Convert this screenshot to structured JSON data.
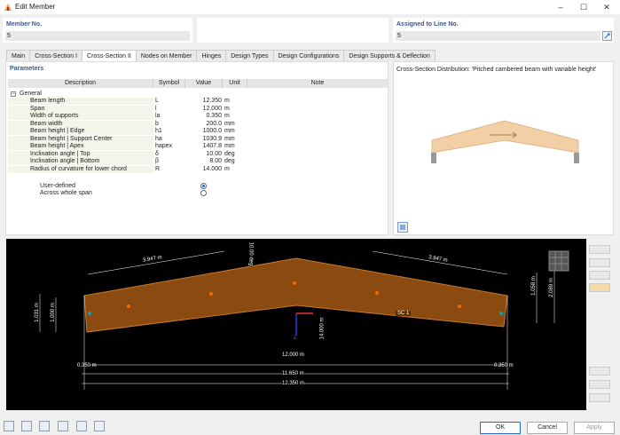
{
  "window": {
    "title": "Edit Member"
  },
  "header": {
    "member_no_label": "Member No.",
    "member_no_value": "5",
    "assigned_label": "Assigned to Line No.",
    "assigned_value": "5"
  },
  "tabs": [
    {
      "label": "Main"
    },
    {
      "label": "Cross-Section I"
    },
    {
      "label": "Cross-Section II"
    },
    {
      "label": "Nodes on Member"
    },
    {
      "label": "Hinges"
    },
    {
      "label": "Design Types"
    },
    {
      "label": "Design Configurations"
    },
    {
      "label": "Design Supports & Deflection"
    }
  ],
  "params": {
    "title": "Parameters",
    "columns": [
      "Description",
      "Symbol",
      "Value",
      "Unit",
      "Note"
    ],
    "group": "General",
    "rows": [
      {
        "desc": "Beam length",
        "sym": "L",
        "val": "12.350",
        "unit": "m"
      },
      {
        "desc": "Span",
        "sym": "l",
        "val": "12.000",
        "unit": "m"
      },
      {
        "desc": "Width of supports",
        "sym": "la",
        "val": "0.350",
        "unit": "m"
      },
      {
        "desc": "Beam width",
        "sym": "b",
        "val": "200.0",
        "unit": "mm"
      },
      {
        "desc": "Beam height | Edge",
        "sym": "h1",
        "val": "1000.0",
        "unit": "mm"
      },
      {
        "desc": "Beam height | Support Center",
        "sym": "ha",
        "val": "1030.9",
        "unit": "mm"
      },
      {
        "desc": "Beam height | Apex",
        "sym": "hapex",
        "val": "1407.8",
        "unit": "mm"
      },
      {
        "desc": "Inclination angle | Top",
        "sym": "δ",
        "val": "10.00",
        "unit": "deg"
      },
      {
        "desc": "Inclination angle | Bottom",
        "sym": "β",
        "val": "8.00",
        "unit": "deg"
      },
      {
        "desc": "Radius of curvature for lower chord",
        "sym": "R",
        "val": "14.000",
        "unit": "m"
      }
    ],
    "radio_user": "User-defined",
    "radio_span": "Across whole span"
  },
  "preview": {
    "title": "Cross-Section Distribution: 'Pitched cambered beam with variable height'"
  },
  "drawing": {
    "dim_top_left": "3.947 m",
    "dim_top_right": "3.947 m",
    "dim_angle": "10.00 deg",
    "dim_h_left1": "1.031 m",
    "dim_h_left2": "1.000 m",
    "dim_h_right1": "1.058 m",
    "dim_h_right2": "2.089 m",
    "dim_z": "14.000 m",
    "label_sc": "SC 1",
    "axis_z": "Z",
    "dim_span": "12.000 m",
    "dim_support_left": "0.350 m",
    "dim_support_right": "0.350 m",
    "dim_inner": "11.650 m",
    "dim_total": "12.350 m"
  },
  "buttons": {
    "ok": "OK",
    "cancel": "Cancel",
    "apply": "Apply"
  }
}
